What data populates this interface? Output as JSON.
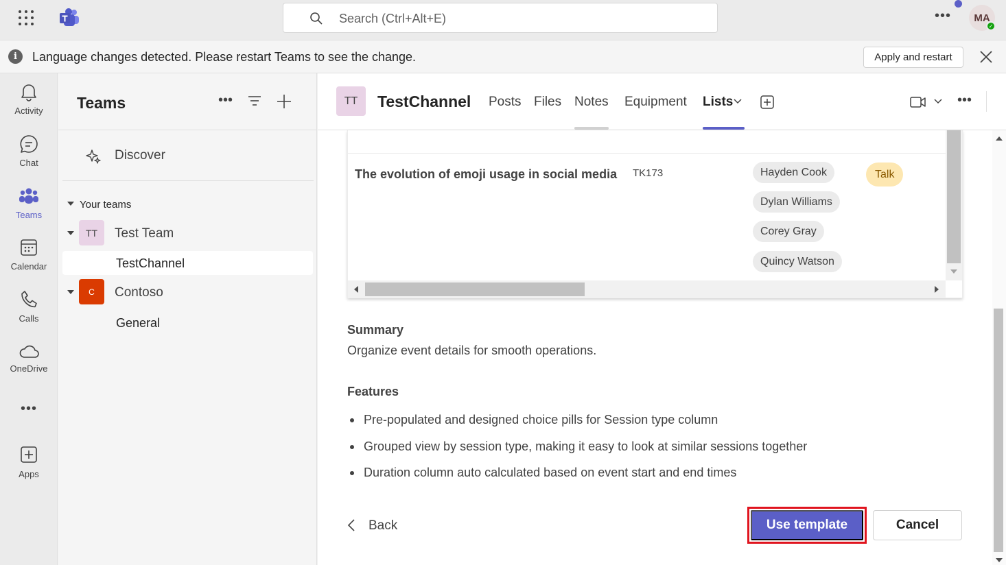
{
  "search": {
    "placeholder": "Search (Ctrl+Alt+E)"
  },
  "user": {
    "initials": "MA"
  },
  "banner": {
    "message": "Language changes detected. Please restart Teams to see the change.",
    "apply_label": "Apply and restart"
  },
  "rail": {
    "items": [
      {
        "label": "Activity",
        "icon": "bell-icon"
      },
      {
        "label": "Chat",
        "icon": "chat-icon"
      },
      {
        "label": "Teams",
        "icon": "teams-icon"
      },
      {
        "label": "Calendar",
        "icon": "calendar-icon"
      },
      {
        "label": "Calls",
        "icon": "phone-icon"
      },
      {
        "label": "OneDrive",
        "icon": "cloud-icon"
      },
      {
        "label": "Apps",
        "icon": "add-app-icon"
      }
    ],
    "more": "•••"
  },
  "panel": {
    "title": "Teams",
    "more": "•••",
    "discover": "Discover",
    "your_teams": "Your teams",
    "teams": [
      {
        "tile": "TT",
        "name": "Test Team",
        "tile_color": "#e9d3e6",
        "channels": [
          "TestChannel"
        ]
      },
      {
        "tile": "C",
        "name": "Contoso",
        "tile_color": "#da3b01",
        "channels": [
          "General"
        ]
      }
    ]
  },
  "channel": {
    "tile": "TT",
    "name": "TestChannel",
    "tabs": [
      "Posts",
      "Files",
      "Notes",
      "Equipment",
      "Lists"
    ],
    "active_tab": "Lists",
    "more": "•••"
  },
  "preview": {
    "row": {
      "title": "The evolution of emoji usage in social media",
      "code": "TK173",
      "speakers": [
        "Hayden Cook",
        "Dylan Williams",
        "Corey Gray",
        "Quincy Watson"
      ],
      "session_type": "Talk"
    }
  },
  "details": {
    "summary_heading": "Summary",
    "summary_text": "Organize event details for smooth operations.",
    "features_heading": "Features",
    "features": [
      "Pre-populated and designed choice pills for Session type column",
      "Grouped view by session type, making it easy to look at similar sessions together",
      "Duration column auto calculated based on event start and end times"
    ]
  },
  "actions": {
    "back": "Back",
    "use_template": "Use template",
    "cancel": "Cancel"
  },
  "colors": {
    "accent": "#5b5fc7",
    "highlight": "#e0141e",
    "talk_pill": "#fde7b1"
  }
}
